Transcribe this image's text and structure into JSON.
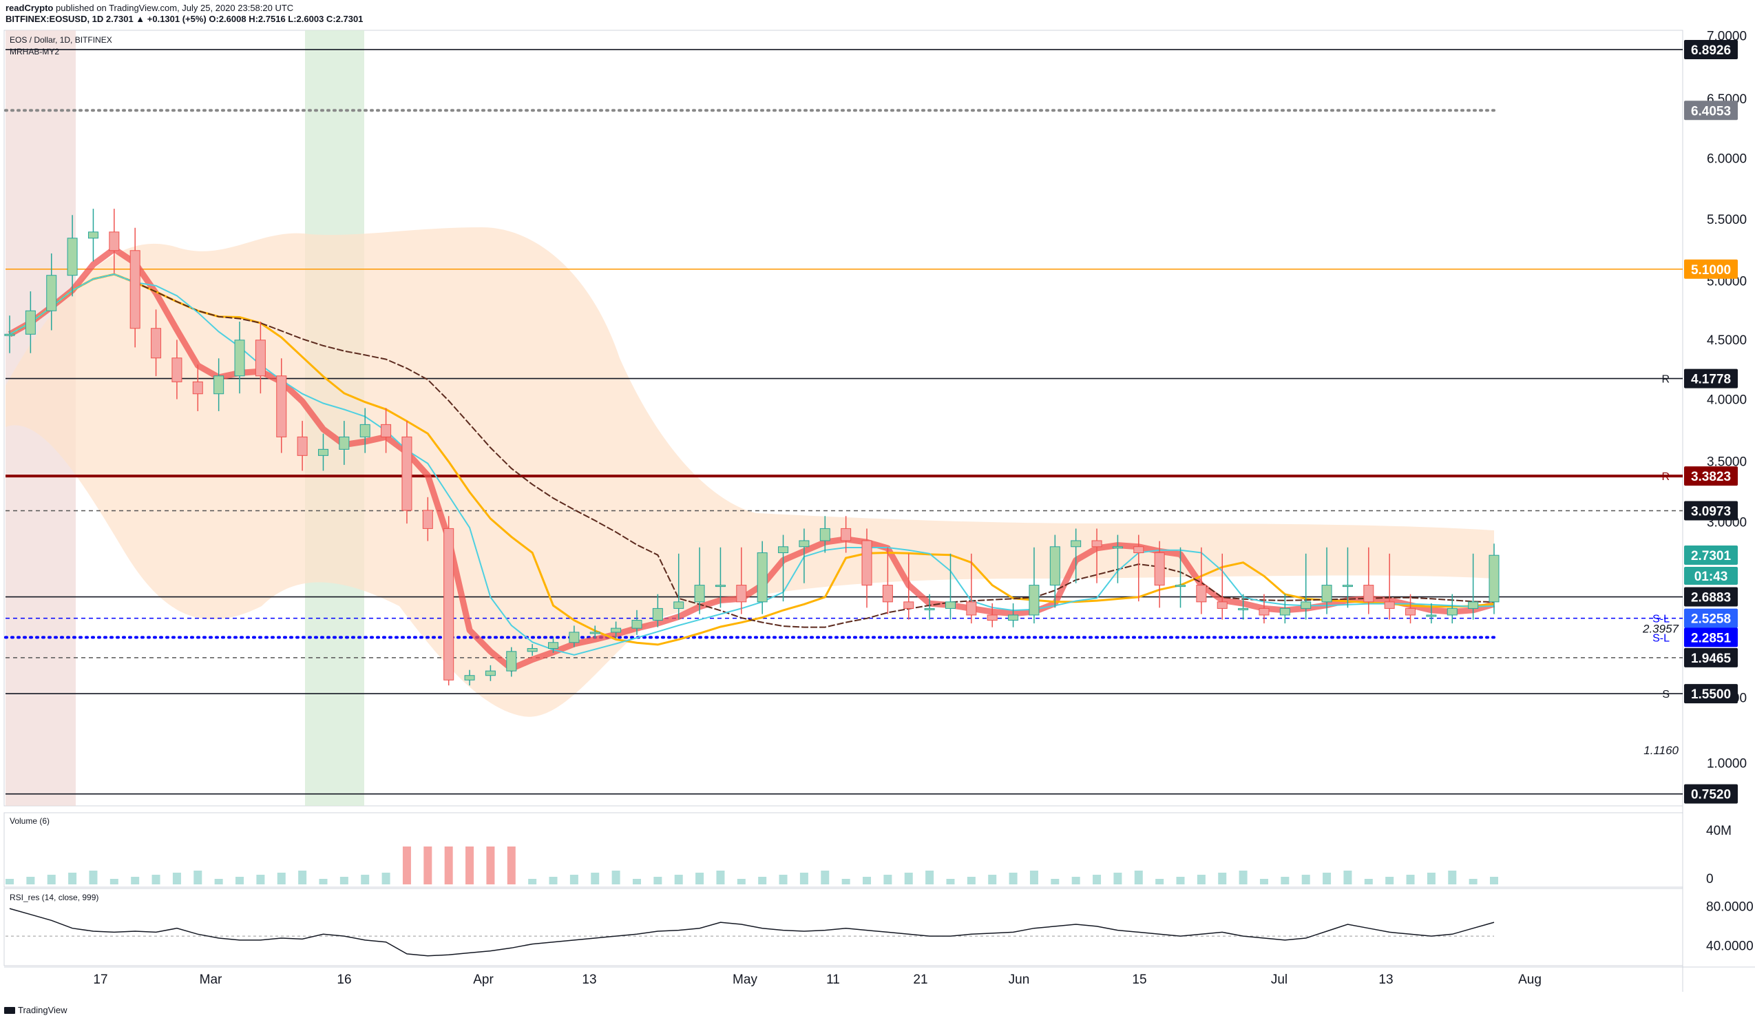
{
  "header": {
    "publisher": "readCrypto",
    "published_text": "published on TradingView.com, July 25, 2020 23:58:20 UTC",
    "symbol_line": "BITFINEX:EOSUSD, 1D 2.7301 ▲ +0.1301 (+5%) O:2.6008 H:2.7516 L:2.6003 C:2.7301"
  },
  "panel": {
    "symbol_label": "EOS / Dollar, 1D, BITFINEX",
    "indicator_label": "MRHAB-MY2",
    "volume_label": "Volume (6)",
    "rsi_label": "RSI_res (14, close, 999)"
  },
  "footer": {
    "brand": "TradingView"
  },
  "chart_data": {
    "type": "candlestick",
    "symbol": "EOS / Dollar, 1D, BITFINEX",
    "y_range": [
      0.7,
      7.0
    ],
    "y_ticks": [
      "7.0000",
      "6.5000",
      "6.0000",
      "5.5000",
      "5.0000",
      "4.5000",
      "4.0000",
      "3.5000",
      "3.0000",
      "1.5000",
      "1.0000"
    ],
    "x_ticks": [
      "17",
      "Mar",
      "16",
      "Apr",
      "13",
      "May",
      "11",
      "21",
      "Jun",
      "15",
      "Jul",
      "13",
      "Aug"
    ],
    "levels": [
      {
        "value": 6.8926,
        "label": "6.8926",
        "style": "solid",
        "color": "#131722",
        "tag": "#131722"
      },
      {
        "value": 6.4053,
        "label": "6.4053",
        "style": "dots",
        "color": "#888888",
        "tag": "#787b86"
      },
      {
        "value": 5.1,
        "label": "5.1000",
        "style": "solid",
        "color": "#ff9800",
        "tag": "#ff9800"
      },
      {
        "value": 4.1778,
        "label": "4.1778",
        "style": "solid",
        "color": "#131722",
        "tag": "#131722",
        "marker": "R"
      },
      {
        "value": 3.3823,
        "label": "3.3823",
        "style": "thick",
        "color": "#8b0000",
        "tag": "#8b0000",
        "marker": "R"
      },
      {
        "value": 3.0973,
        "label": "3.0973",
        "style": "dashed",
        "color": "#555555",
        "tag": "#131722"
      },
      {
        "value": 2.7301,
        "label": "2.7301",
        "style": "none",
        "color": "#26a69a",
        "tag": "#26a69a"
      },
      {
        "value": 2.6883,
        "label": "2.6883",
        "style": "solid",
        "color": "#131722",
        "tag": "#131722"
      },
      {
        "value": 2.5258,
        "label": "2.5258",
        "style": "dashed",
        "color": "#0000ff",
        "tag": "#2962ff",
        "marker": "S-L"
      },
      {
        "value": 2.2851,
        "label": "2.2851",
        "style": "dots",
        "color": "#0000ff",
        "tag": "#0000ff",
        "marker": "S-L"
      },
      {
        "value": 1.9465,
        "label": "1.9465",
        "style": "dashed",
        "color": "#555555",
        "tag": "#131722"
      },
      {
        "value": 1.55,
        "label": "1.5500",
        "style": "solid",
        "color": "#131722",
        "tag": "#131722",
        "marker": "S"
      },
      {
        "value": 0.752,
        "label": "0.7520",
        "style": "solid",
        "color": "#131722",
        "tag": "#131722"
      }
    ],
    "annotations": [
      {
        "value": 2.3957,
        "label": "2.3957"
      },
      {
        "value": 1.116,
        "label": "1.1160"
      }
    ],
    "countdown": "01:43",
    "candles": [
      4.55,
      4.75,
      5.05,
      5.35,
      5.4,
      5.25,
      4.6,
      4.35,
      4.15,
      4.05,
      4.2,
      4.5,
      4.2,
      3.7,
      3.55,
      3.6,
      3.7,
      3.8,
      3.7,
      3.1,
      2.95,
      1.7,
      1.75,
      1.8,
      2.05,
      2.1,
      2.2,
      2.35,
      2.35,
      2.4,
      2.5,
      2.6,
      2.65,
      2.7,
      2.7,
      2.65,
      2.75,
      2.8,
      2.85,
      2.95,
      2.85,
      2.7,
      2.65,
      2.6,
      2.6,
      2.65,
      2.55,
      2.5,
      2.55,
      2.7,
      2.8,
      2.85,
      2.8,
      2.8,
      2.75,
      2.7,
      2.7,
      2.65,
      2.6,
      2.6,
      2.55,
      2.6,
      2.65,
      2.7,
      2.7,
      2.65,
      2.6,
      2.55,
      2.55,
      2.6,
      2.65,
      2.73
    ],
    "volume": {
      "label": "Volume (6)",
      "ticks": [
        "40M",
        "0"
      ]
    },
    "rsi": {
      "label": "RSI_res (14, close, 999)",
      "ticks": [
        "80.0000",
        "40.0000"
      ],
      "values": [
        78,
        72,
        66,
        58,
        55,
        54,
        55,
        54,
        58,
        52,
        48,
        46,
        46,
        48,
        47,
        52,
        50,
        46,
        44,
        32,
        30,
        31,
        33,
        35,
        38,
        42,
        44,
        46,
        48,
        50,
        52,
        55,
        56,
        58,
        64,
        62,
        58,
        56,
        55,
        56,
        58,
        56,
        54,
        52,
        50,
        50,
        52,
        53,
        54,
        58,
        60,
        62,
        60,
        56,
        54,
        52,
        50,
        52,
        54,
        50,
        48,
        46,
        48,
        55,
        62,
        58,
        54,
        52,
        50,
        52,
        58,
        64
      ]
    }
  }
}
